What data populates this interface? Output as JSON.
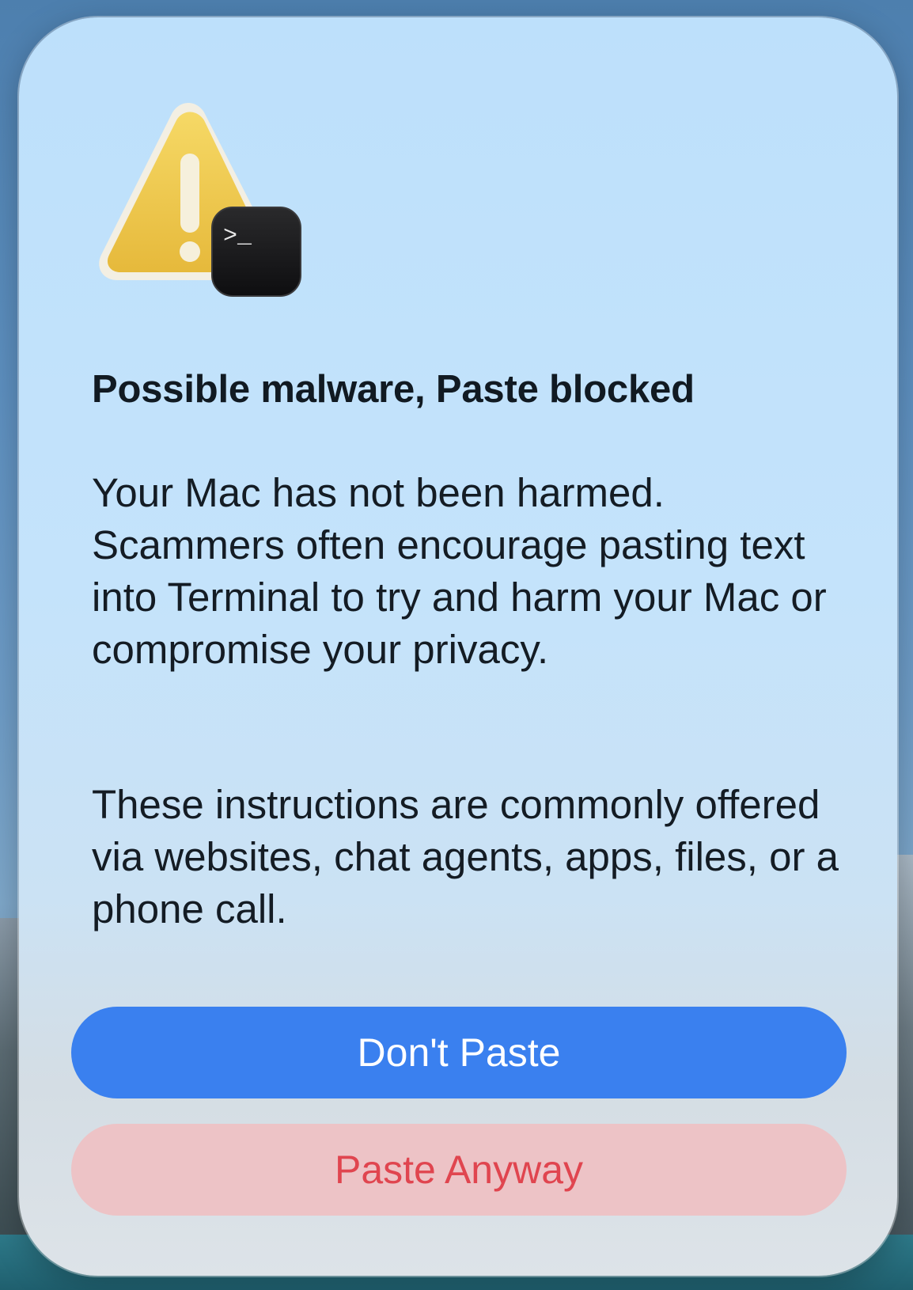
{
  "dialog": {
    "title": "Possible malware, Paste blocked",
    "message_paragraphs": [
      "Your Mac has not been harmed. Scammers often encourage pasting text into Terminal to try and harm your Mac or compromise your privacy.",
      "These instructions are commonly offered via websites, chat agents, apps, files, or a phone call."
    ],
    "icon": {
      "main": "warning-triangle-icon",
      "badge": "terminal-app-icon",
      "badge_prompt": ">_"
    },
    "buttons": {
      "primary_label": "Don't Paste",
      "secondary_label": "Paste Anyway"
    }
  },
  "colors": {
    "primary_button": "#3a80ef",
    "destructive_text": "#e0454f",
    "destructive_bg": "#edc3c6",
    "warning_yellow": "#f2c744",
    "dialog_bg": "#c4e3fb"
  }
}
